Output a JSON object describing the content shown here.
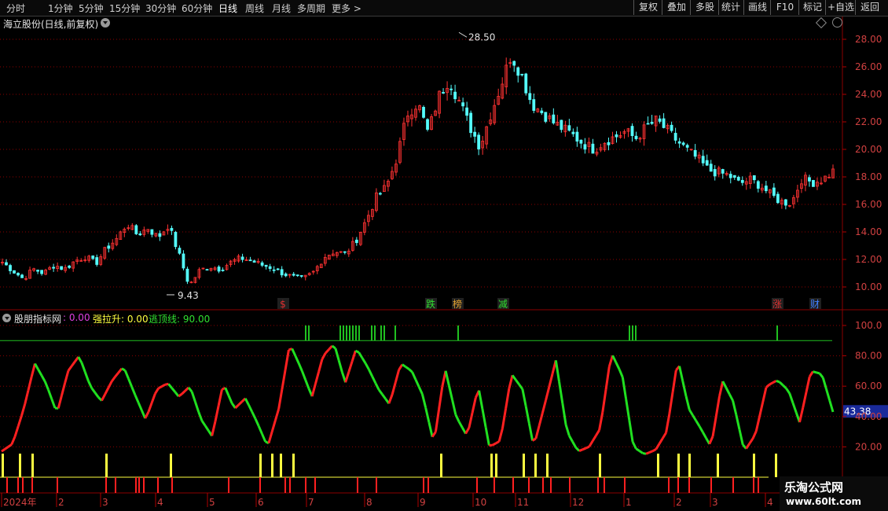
{
  "toolbar": {
    "periods": [
      "分时",
      "1分钟",
      "5分钟",
      "15分钟",
      "30分钟",
      "60分钟",
      "日线",
      "周线",
      "月线",
      "多周期",
      "更多 >"
    ],
    "active_period": "日线",
    "buttons": [
      "复权",
      "叠加",
      "多股",
      "统计",
      "画线",
      "F10",
      "标记",
      "+自选",
      "返回"
    ]
  },
  "main_chart": {
    "title": "海立股份(日线,前复权)",
    "high_label": "28.50",
    "low_label": "9.43",
    "y_ticks": [
      "28.00",
      "26.00",
      "24.00",
      "22.00",
      "20.00",
      "18.00",
      "16.00",
      "14.00",
      "12.00",
      "10.00"
    ],
    "event_markers": [
      {
        "text": "$",
        "color": "#e03030"
      },
      {
        "text": "跌",
        "color": "#30e030"
      },
      {
        "text": "榜",
        "color": "#e0a030"
      },
      {
        "text": "减",
        "color": "#30e030"
      },
      {
        "text": "涨",
        "color": "#e03030"
      },
      {
        "text": "财",
        "color": "#4080ff"
      }
    ]
  },
  "indicator": {
    "name": "股朋指标网",
    "v1": ": 0.00",
    "v2_label": "强拉升: 0.00",
    "v3_label": "逃顶线: 90.00",
    "y_ticks": [
      "100.0",
      "80.00",
      "60.00",
      "40.00",
      "20.00"
    ],
    "current_value": "43.38"
  },
  "x_axis": {
    "labels": [
      "2024年",
      "2",
      "3",
      "4",
      "5",
      "6",
      "7",
      "8",
      "9",
      "10",
      "11",
      "12",
      "1",
      "2",
      "3",
      "4"
    ]
  },
  "watermark": {
    "title": "乐淘公式网",
    "url": "www.60lt.com"
  },
  "colors": {
    "up": "#ff3232",
    "down": "#54fcfc",
    "grid": "#8b0000",
    "ind_up": "#ff2020",
    "ind_down": "#20e020",
    "threshold": "#20c020",
    "yellow": "#ffff40"
  },
  "chart_data": [
    {
      "type": "candlestick",
      "title": "海立股份(日线,前复权)",
      "ylim": [
        9,
        29
      ],
      "x": [
        "2024-01",
        "2024-02",
        "2024-03",
        "2024-04",
        "2024-05",
        "2024-06",
        "2024-07",
        "2024-08",
        "2024-09",
        "2024-10",
        "2024-11",
        "2024-12",
        "2025-01",
        "2025-02",
        "2025-03",
        "2025-04"
      ],
      "close_path": [
        11.8,
        11.2,
        10.6,
        11.3,
        11.0,
        11.6,
        11.3,
        11.9,
        12.2,
        11.7,
        12.8,
        13.5,
        14.6,
        13.8,
        14.3,
        13.6,
        14.5,
        12.4,
        10.1,
        11.2,
        11.5,
        11.3,
        11.8,
        12.1,
        11.9,
        11.6,
        11.4,
        11.0,
        10.7,
        10.6,
        11.1,
        12.2,
        12.6,
        12.4,
        13.3,
        14.8,
        16.5,
        17.3,
        19.4,
        22.6,
        23.4,
        21.2,
        23.8,
        25.1,
        23.5,
        21.7,
        20.2,
        22.5,
        24.6,
        26.9,
        25.4,
        23.3,
        22.7,
        22.0,
        21.5,
        21.0,
        20.4,
        20.0,
        20.6,
        20.9,
        21.3,
        20.8,
        21.6,
        22.1,
        21.4,
        20.6,
        19.9,
        19.3,
        18.5,
        18.3,
        18.1,
        17.5,
        17.8,
        17.4,
        16.7,
        16.2,
        16.1,
        17.9,
        17.6,
        17.8,
        18.4
      ],
      "high": 28.5,
      "low": 9.43
    },
    {
      "type": "line",
      "title": "股朋指标网",
      "ylim": [
        0,
        105
      ],
      "threshold": 90,
      "series": [
        {
          "name": "强拉升",
          "values": [
            17,
            22,
            45,
            75,
            62,
            42,
            70,
            80,
            60,
            50,
            64,
            73,
            55,
            38,
            58,
            62,
            53,
            60,
            38,
            27,
            62,
            45,
            52,
            37,
            20,
            45,
            88,
            72,
            53,
            80,
            88,
            62,
            85,
            73,
            58,
            48,
            75,
            70,
            54,
            22,
            72,
            40,
            27,
            60,
            20,
            24,
            68,
            58,
            20,
            48,
            77,
            30,
            17,
            20,
            32,
            82,
            67,
            20,
            15,
            18,
            30,
            78,
            45,
            33,
            20,
            64,
            50,
            17,
            28,
            60,
            64,
            57,
            36,
            70,
            68,
            43
          ]
        }
      ],
      "current_value": 43.38
    }
  ]
}
